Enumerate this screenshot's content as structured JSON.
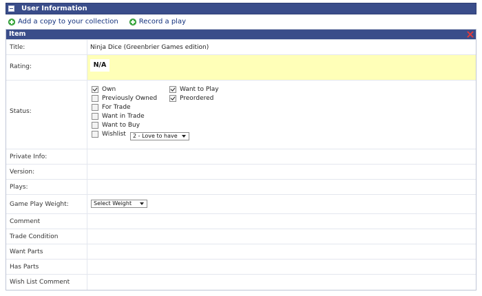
{
  "header": {
    "title": "User Information"
  },
  "actions": [
    {
      "label": "Add a copy to your collection",
      "icon": "plus-circle-icon"
    },
    {
      "label": "Record a play",
      "icon": "plus-circle-icon"
    }
  ],
  "item": {
    "title_header": "Item",
    "title_label": "Title:",
    "title_value": "Ninja Dice (Greenbrier Games edition)",
    "rating_label": "Rating:",
    "rating_value": "N/A",
    "status_label": "Status:",
    "status": [
      {
        "label": "Own",
        "checked": true
      },
      {
        "label": "Previously Owned",
        "checked": false
      },
      {
        "label": "For Trade",
        "checked": false
      },
      {
        "label": "Want in Trade",
        "checked": false
      },
      {
        "label": "Want to Buy",
        "checked": false
      },
      {
        "label": "Wishlist",
        "checked": false
      },
      {
        "label": "Want to Play",
        "checked": true
      },
      {
        "label": "Preordered",
        "checked": true
      }
    ],
    "wishlist_select": "2 - Love to have",
    "private_info_label": "Private Info:",
    "version_label": "Version:",
    "plays_label": "Plays:",
    "weight_label": "Game Play Weight:",
    "weight_select": "Select Weight",
    "comment_label": "Comment",
    "trade_condition_label": "Trade Condition",
    "want_parts_label": "Want Parts",
    "has_parts_label": "Has Parts",
    "wishlist_comment_label": "Wish List Comment"
  },
  "colors": {
    "header_bg": "#3a4d8a",
    "rating_bg": "#ffffb8",
    "link": "#12307c",
    "close": "#e13a3a"
  }
}
